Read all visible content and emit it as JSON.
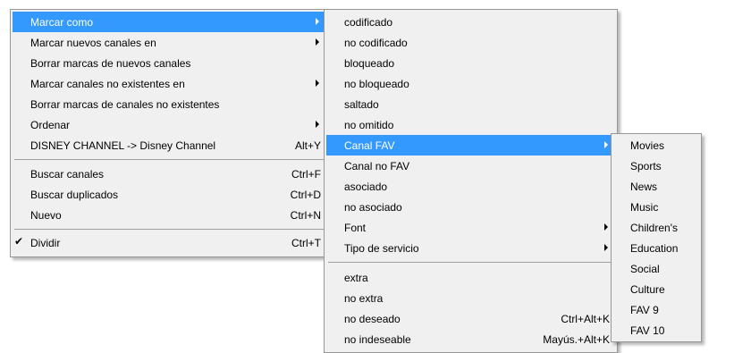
{
  "main_menu": {
    "items": [
      {
        "label": "Marcar como",
        "shortcut": ""
      },
      {
        "label": "Marcar nuevos canales en",
        "shortcut": ""
      },
      {
        "label": "Borrar marcas de nuevos canales",
        "shortcut": ""
      },
      {
        "label": "Marcar canales no existentes en",
        "shortcut": ""
      },
      {
        "label": "Borrar marcas de canales no existentes",
        "shortcut": ""
      },
      {
        "label": "Ordenar",
        "shortcut": ""
      },
      {
        "label": "DISNEY CHANNEL -> Disney Channel",
        "shortcut": "Alt+Y"
      },
      {
        "label": "Buscar canales",
        "shortcut": "Ctrl+F"
      },
      {
        "label": "Buscar duplicados",
        "shortcut": "Ctrl+D"
      },
      {
        "label": "Nuevo",
        "shortcut": "Ctrl+N"
      },
      {
        "label": "Dividir",
        "shortcut": "Ctrl+T",
        "check": "✔"
      }
    ]
  },
  "mark_as_menu": {
    "items": [
      {
        "label": "codificado",
        "shortcut": ""
      },
      {
        "label": "no codificado",
        "shortcut": ""
      },
      {
        "label": "bloqueado",
        "shortcut": ""
      },
      {
        "label": "no bloqueado",
        "shortcut": ""
      },
      {
        "label": "saltado",
        "shortcut": ""
      },
      {
        "label": "no omitido",
        "shortcut": ""
      },
      {
        "label": "Canal FAV",
        "shortcut": ""
      },
      {
        "label": "Canal no FAV",
        "shortcut": ""
      },
      {
        "label": "asociado",
        "shortcut": ""
      },
      {
        "label": "no asociado",
        "shortcut": ""
      },
      {
        "label": "Font",
        "shortcut": ""
      },
      {
        "label": "Tipo de servicio",
        "shortcut": ""
      },
      {
        "label": "extra",
        "shortcut": ""
      },
      {
        "label": "no extra",
        "shortcut": ""
      },
      {
        "label": "no deseado",
        "shortcut": "Ctrl+Alt+K"
      },
      {
        "label": "no indeseable",
        "shortcut": "Mayús.+Alt+K"
      }
    ]
  },
  "fav_menu": {
    "items": [
      {
        "label": "Movies"
      },
      {
        "label": "Sports"
      },
      {
        "label": "News"
      },
      {
        "label": "Music"
      },
      {
        "label": "Children's"
      },
      {
        "label": "Education"
      },
      {
        "label": "Social"
      },
      {
        "label": "Culture"
      },
      {
        "label": "FAV 9"
      },
      {
        "label": "FAV 10"
      }
    ]
  },
  "colors": {
    "highlight": "#3399ff",
    "menu_bg": "#f0f0f0",
    "border": "#979797"
  }
}
